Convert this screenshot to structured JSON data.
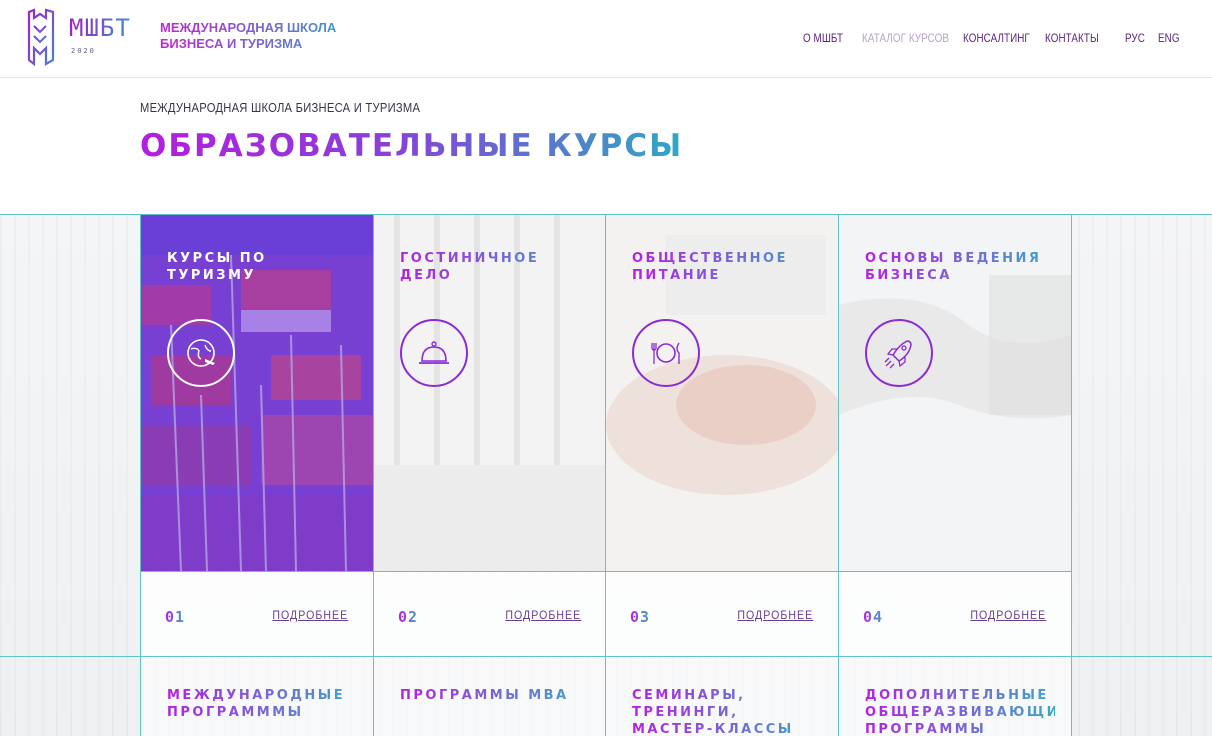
{
  "header": {
    "logo_abbr": "МШБТ",
    "logo_year": "2020",
    "logo_name": "МЕЖДУНАРОДНАЯ ШКОЛА БИЗНЕСА И ТУРИЗМА",
    "nav": [
      {
        "label": "О МШБТ",
        "active": false
      },
      {
        "label": "КАТАЛОГ КУРСОВ",
        "active": true
      },
      {
        "label": "КОНСАЛТИНГ",
        "active": false
      },
      {
        "label": "КОНТАКТЫ",
        "active": false
      }
    ],
    "lang": [
      "РУС",
      "ENG"
    ]
  },
  "page": {
    "breadcrumb": "МЕЖДУНАРОДНАЯ ШКОЛА БИЗНЕСА И ТУРИЗМА",
    "title": "ОБРАЗОВАТЕЛЬНЫЕ КУРСЫ"
  },
  "cards": [
    {
      "title": "КУРСЫ ПО ТУРИЗМУ",
      "icon": "globe-plane-icon",
      "number": "01",
      "more": "ПОДРОБНЕЕ"
    },
    {
      "title": "ГОСТИНИЧНОЕ ДЕЛО",
      "icon": "service-bell-icon",
      "number": "02",
      "more": "ПОДРОБНЕЕ"
    },
    {
      "title": "ОБЩЕСТВЕННОЕ ПИТАНИЕ",
      "icon": "plate-cutlery-icon",
      "number": "03",
      "more": "ПОДРОБНЕЕ"
    },
    {
      "title": "ОСНОВЫ ВЕДЕНИЯ БИЗНЕСА",
      "icon": "rocket-icon",
      "number": "04",
      "more": "ПОДРОБНЕЕ"
    }
  ],
  "cards_row2": [
    {
      "title": "МЕЖДУНАРОДНЫЕ ПРОГРАМММЫ"
    },
    {
      "title": "ПРОГРАММЫ MBA"
    },
    {
      "title": "СЕМИНАРЫ, ТРЕНИНГИ, МАСТЕР-КЛАССЫ"
    },
    {
      "title": "ДОПОЛНИТЕЛЬНЫЕ ОБЩЕРАЗВИВАЮЩИЕ ПРОГРАММЫ"
    }
  ],
  "colors": {
    "accent_purple": "#8a2bd6",
    "accent_teal": "#3aa8c8",
    "grid_line": "#5fc3c8",
    "featured_overlay": "#6a3fd8"
  }
}
